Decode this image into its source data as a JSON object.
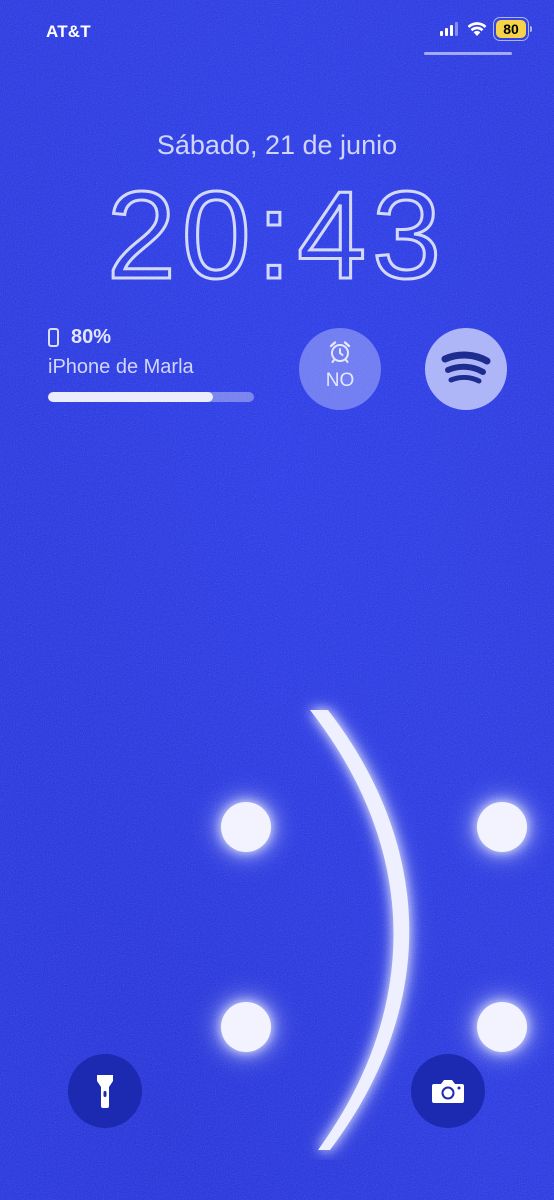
{
  "status_bar": {
    "carrier": "AT&T",
    "signal_bars": 4,
    "signal_bars_active": 3,
    "wifi_icon": "wifi-icon",
    "battery_level": "80"
  },
  "lock_screen": {
    "date": "Sábado, 21 de junio",
    "time": "20:43"
  },
  "widgets": {
    "battery": {
      "icon": "iphone-icon",
      "percent": "80%",
      "device_name": "iPhone de Marla",
      "level": 0.8
    },
    "alarm": {
      "icon": "alarm-clock-icon",
      "label": "NO"
    },
    "spotify": {
      "icon": "spotify-logo-icon"
    }
  },
  "quick_actions": {
    "flashlight": {
      "icon": "flashlight-icon"
    },
    "camera": {
      "icon": "camera-icon"
    }
  },
  "colors": {
    "background": "#2233e8",
    "battery_badge": "#f5d44a",
    "button_bg": "#1b2ab0"
  }
}
